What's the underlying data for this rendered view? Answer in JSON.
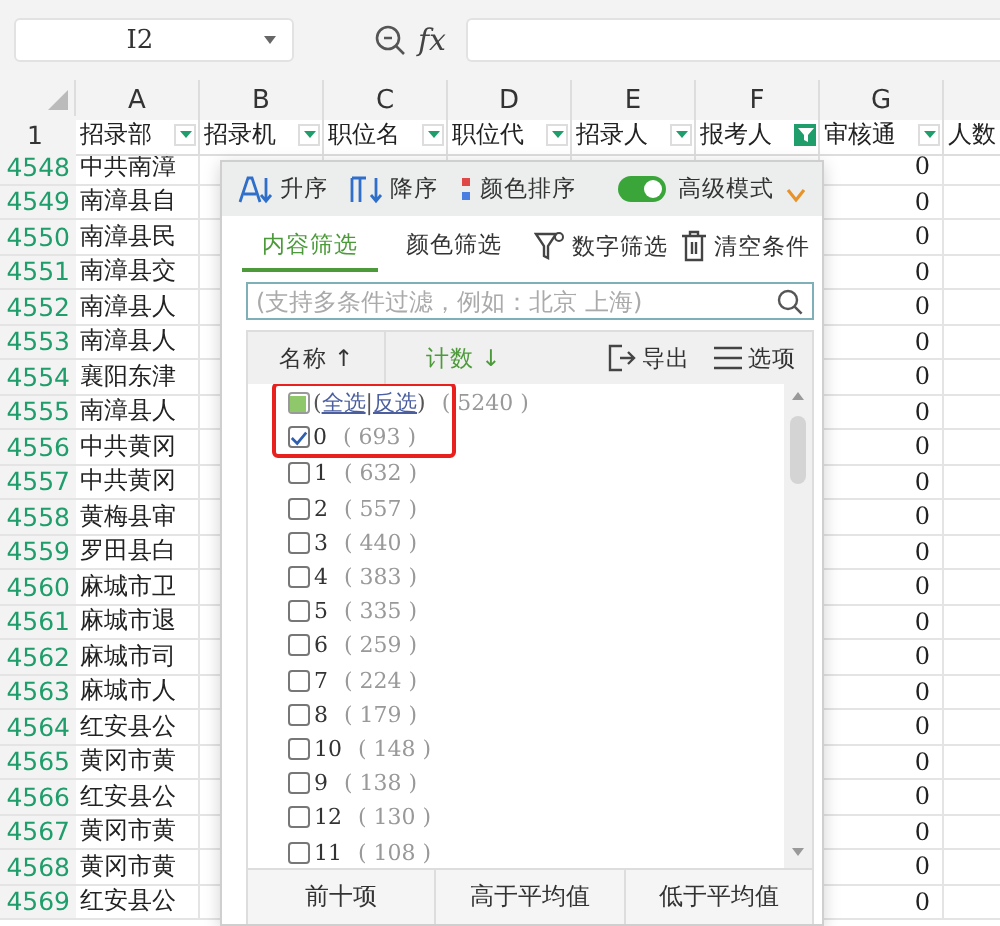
{
  "formula_bar": {
    "cell_ref": "I2",
    "fx": "fx"
  },
  "grid": {
    "column_letters": [
      "A",
      "B",
      "C",
      "D",
      "E",
      "F",
      "G"
    ],
    "header_row": {
      "number": "1",
      "cells": [
        {
          "text": "招录部",
          "filter_active": false
        },
        {
          "text": "招录机",
          "filter_active": false
        },
        {
          "text": "职位名",
          "filter_active": false
        },
        {
          "text": "职位代",
          "filter_active": false
        },
        {
          "text": "招录人",
          "filter_active": false
        },
        {
          "text": "报考人",
          "filter_active": true
        },
        {
          "text": "审核通",
          "filter_active": false
        },
        {
          "text": "人数"
        }
      ]
    },
    "rows": [
      {
        "number": "4548",
        "column_a": "中共南漳",
        "column_g": "0"
      },
      {
        "number": "4549",
        "column_a": "南漳县自",
        "column_g": "0"
      },
      {
        "number": "4550",
        "column_a": "南漳县民",
        "column_g": "0"
      },
      {
        "number": "4551",
        "column_a": "南漳县交",
        "column_g": "0"
      },
      {
        "number": "4552",
        "column_a": "南漳县人",
        "column_g": "0"
      },
      {
        "number": "4553",
        "column_a": "南漳县人",
        "column_g": "0"
      },
      {
        "number": "4554",
        "column_a": "襄阳东津",
        "column_g": "0"
      },
      {
        "number": "4555",
        "column_a": "南漳县人",
        "column_g": "0"
      },
      {
        "number": "4556",
        "column_a": "中共黄冈",
        "column_g": "0"
      },
      {
        "number": "4557",
        "column_a": "中共黄冈",
        "column_g": "0"
      },
      {
        "number": "4558",
        "column_a": "黄梅县审",
        "column_g": "0"
      },
      {
        "number": "4559",
        "column_a": "罗田县白",
        "column_g": "0"
      },
      {
        "number": "4560",
        "column_a": "麻城市卫",
        "column_g": "0"
      },
      {
        "number": "4561",
        "column_a": "麻城市退",
        "column_g": "0"
      },
      {
        "number": "4562",
        "column_a": "麻城市司",
        "column_g": "0"
      },
      {
        "number": "4563",
        "column_a": "麻城市人",
        "column_g": "0"
      },
      {
        "number": "4564",
        "column_a": "红安县公",
        "column_g": "0"
      },
      {
        "number": "4565",
        "column_a": "黄冈市黄",
        "column_g": "0"
      },
      {
        "number": "4566",
        "column_a": "红安县公",
        "column_g": "0"
      },
      {
        "number": "4567",
        "column_a": "黄冈市黄",
        "column_g": "0"
      },
      {
        "number": "4568",
        "column_a": "黄冈市黄",
        "column_g": "0"
      },
      {
        "number": "4569",
        "column_a": "红安县公",
        "column_g": "0"
      }
    ]
  },
  "filter_popup": {
    "sort_buttons": [
      {
        "kind": "ascending",
        "label": "升序"
      },
      {
        "kind": "descending",
        "label": "降序"
      },
      {
        "kind": "color",
        "label": "颜色排序"
      }
    ],
    "advanced_mode": {
      "label": "高级模式",
      "on": true
    },
    "tabs": [
      {
        "label": "内容筛选",
        "selected": true
      },
      {
        "label": "颜色筛选",
        "selected": false
      }
    ],
    "actions": [
      {
        "kind": "number-filter",
        "label": "数字筛选"
      },
      {
        "kind": "clear",
        "label": "清空条件"
      }
    ],
    "search": {
      "placeholder": "(支持多条件过滤，例如：北京 上海)"
    },
    "list_header": {
      "name": "名称",
      "name_arrow": "↑",
      "count": "计数",
      "count_arrow": "↓",
      "export": "导出",
      "options": "选项"
    },
    "items": [
      {
        "kind": "select-all",
        "prefix": "(",
        "links": [
          "全选",
          "反选"
        ],
        "separator": "|",
        "suffix": ")",
        "count": "( 5240 )",
        "checked": false,
        "indeterminate": true,
        "highlighted": true
      },
      {
        "kind": "value",
        "label": "0",
        "count": "( 693 )",
        "checked": true,
        "indeterminate": false,
        "highlighted": true
      },
      {
        "kind": "value",
        "label": "1",
        "count": "( 632 )",
        "checked": false,
        "indeterminate": false,
        "highlighted": false
      },
      {
        "kind": "value",
        "label": "2",
        "count": "( 557 )",
        "checked": false,
        "indeterminate": false,
        "highlighted": false
      },
      {
        "kind": "value",
        "label": "3",
        "count": "( 440 )",
        "checked": false,
        "indeterminate": false,
        "highlighted": false
      },
      {
        "kind": "value",
        "label": "4",
        "count": "( 383 )",
        "checked": false,
        "indeterminate": false,
        "highlighted": false
      },
      {
        "kind": "value",
        "label": "5",
        "count": "( 335 )",
        "checked": false,
        "indeterminate": false,
        "highlighted": false
      },
      {
        "kind": "value",
        "label": "6",
        "count": "( 259 )",
        "checked": false,
        "indeterminate": false,
        "highlighted": false
      },
      {
        "kind": "value",
        "label": "7",
        "count": "( 224 )",
        "checked": false,
        "indeterminate": false,
        "highlighted": false
      },
      {
        "kind": "value",
        "label": "8",
        "count": "( 179 )",
        "checked": false,
        "indeterminate": false,
        "highlighted": false
      },
      {
        "kind": "value",
        "label": "10",
        "count": "( 148 )",
        "checked": false,
        "indeterminate": false,
        "highlighted": false
      },
      {
        "kind": "value",
        "label": "9",
        "count": "( 138 )",
        "checked": false,
        "indeterminate": false,
        "highlighted": false
      },
      {
        "kind": "value",
        "label": "12",
        "count": "( 130 )",
        "checked": false,
        "indeterminate": false,
        "highlighted": false
      },
      {
        "kind": "value",
        "label": "11",
        "count": "( 108 )",
        "checked": false,
        "indeterminate": false,
        "highlighted": false
      }
    ],
    "bottom_buttons": [
      "前十项",
      "高于平均值",
      "低于平均值"
    ]
  }
}
